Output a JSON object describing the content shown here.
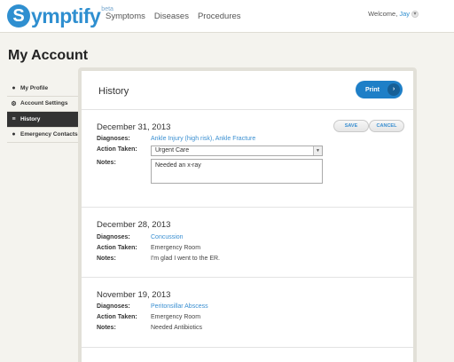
{
  "header": {
    "logo_mark": "S",
    "logo_text": "ymptify",
    "logo_beta": "beta",
    "nav": [
      "Symptoms",
      "Diseases",
      "Procedures"
    ],
    "welcome_prefix": "Welcome,",
    "username": "Jay"
  },
  "page_title": "My Account",
  "sidebar": {
    "items": [
      {
        "label": "My Profile",
        "icon": "person-icon",
        "glyph": "👤",
        "active": false
      },
      {
        "label": "Account Settings",
        "icon": "gear-icon",
        "glyph": "⚙",
        "active": false
      },
      {
        "label": "History",
        "icon": "list-icon",
        "glyph": "≡",
        "active": true
      },
      {
        "label": "Emergency Contacts",
        "icon": "people-icon",
        "glyph": "👥",
        "active": false
      }
    ]
  },
  "panel": {
    "title": "History",
    "print_label": "Print"
  },
  "labels": {
    "diagnoses": "Diagnoses:",
    "action_taken": "Action Taken:",
    "notes": "Notes:",
    "save": "SAVE",
    "cancel": "CANCEL"
  },
  "entries": [
    {
      "date": "December 31, 2013",
      "diagnoses": "Ankle Injury (high risk), Ankle Fracture",
      "action_taken": "Urgent Care",
      "notes": "Needed an x-ray",
      "editing": true
    },
    {
      "date": "December 28, 2013",
      "diagnoses": "Concussion",
      "action_taken": "Emergency Room",
      "notes": "I'm glad I went to the ER."
    },
    {
      "date": "November 19, 2013",
      "diagnoses": "Peritonsillar Abscess",
      "action_taken": "Emergency Room",
      "notes": "Needed Antibiotics"
    }
  ],
  "colors": {
    "brand_blue": "#2f8fd0",
    "link_blue": "#3a8fd1",
    "sidebar_active": "#333333",
    "background": "#f4f3ee"
  }
}
